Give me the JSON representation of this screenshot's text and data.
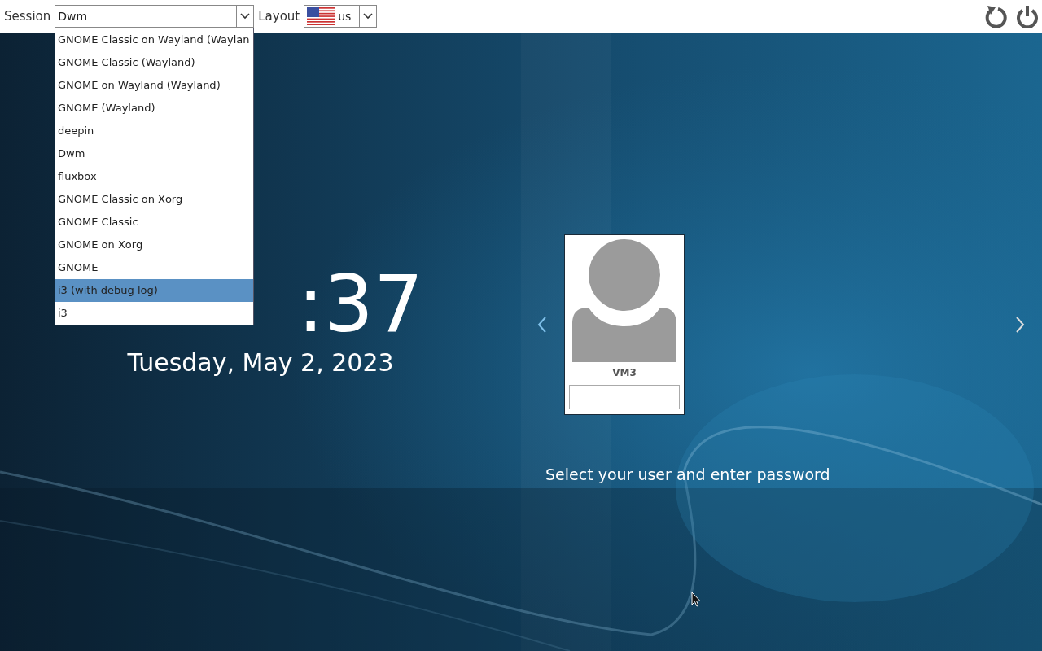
{
  "top_bar": {
    "session_label": "Session",
    "session_value": "Dwm",
    "layout_label": "Layout",
    "layout_value": "us"
  },
  "session_menu": {
    "items": [
      {
        "label": "GNOME Classic on Wayland (Waylan",
        "selected": false
      },
      {
        "label": "GNOME Classic (Wayland)",
        "selected": false
      },
      {
        "label": "GNOME on Wayland (Wayland)",
        "selected": false
      },
      {
        "label": "GNOME (Wayland)",
        "selected": false
      },
      {
        "label": "deepin",
        "selected": false
      },
      {
        "label": "Dwm",
        "selected": false
      },
      {
        "label": "fluxbox",
        "selected": false
      },
      {
        "label": "GNOME Classic on Xorg",
        "selected": false
      },
      {
        "label": "GNOME Classic",
        "selected": false
      },
      {
        "label": "GNOME on Xorg",
        "selected": false
      },
      {
        "label": "GNOME",
        "selected": false
      },
      {
        "label": "i3 (with debug log)",
        "selected": true
      },
      {
        "label": "i3",
        "selected": false
      }
    ]
  },
  "clock": {
    "time": ":37",
    "date": "Tuesday, May 2, 2023"
  },
  "user": {
    "name": "VM3",
    "prompt": "Select your user and enter password"
  }
}
